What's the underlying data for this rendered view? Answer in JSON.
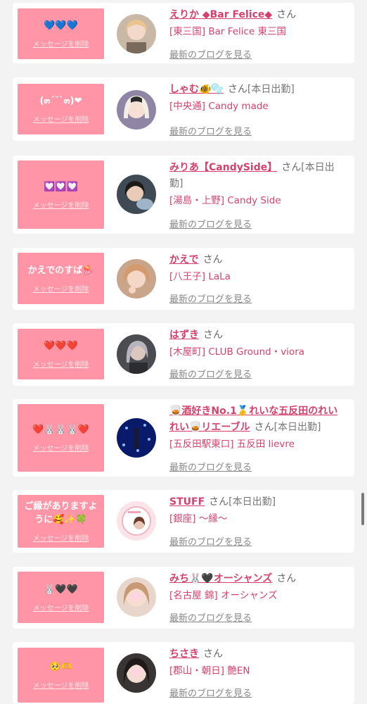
{
  "items": [
    {
      "message": "💙💙💙",
      "delete_label": "メッセージを削除",
      "name": "えりか ◆Bar Felice◆",
      "honorific": "さん",
      "tag": "",
      "shop": "[東三国] Bar Felice 東三国",
      "blog_label": "最新のブログを見る",
      "avatar_icon": "profile-photo-icon"
    },
    {
      "message": "(๓´˘`๓)❤",
      "delete_label": "メッセージを削除",
      "name": "しゃむ🐠🫧",
      "honorific": "さん",
      "tag": "[本日出勤]",
      "shop": "[中央通] Candy made",
      "blog_label": "最新のブログを見る",
      "avatar_icon": "profile-photo-icon"
    },
    {
      "message": "💟💟💟",
      "delete_label": "メッセージを削除",
      "name": "みりあ【CandySide】",
      "honorific": "さん",
      "tag": "[本日出勤]",
      "shop": "[湯島・上野] Candy Side",
      "blog_label": "最新のブログを見る",
      "avatar_icon": "profile-photo-icon"
    },
    {
      "message": "かえでのすば🪼",
      "delete_label": "メッセージを削除",
      "name": "かえで",
      "honorific": "さん",
      "tag": "",
      "shop": "[八王子] LaLa",
      "blog_label": "最新のブログを見る",
      "avatar_icon": "profile-photo-icon"
    },
    {
      "message": "❤️❤️❤️",
      "delete_label": "メッセージを削除",
      "name": "はずき",
      "honorific": "さん",
      "tag": "",
      "shop": "[木屋町] CLUB Ground・viora",
      "blog_label": "最新のブログを見る",
      "avatar_icon": "profile-photo-icon"
    },
    {
      "message": "❤️🐰🐰🐰❤️",
      "delete_label": "メッセージを削除",
      "name": "🥃酒好きNo.1🥇れいな五反田のれいれい🥃リエーブル",
      "honorific": "さん",
      "tag": "[本日出勤]",
      "shop": "[五反田駅東口] 五反田 lievre",
      "blog_label": "最新のブログを見る",
      "avatar_icon": "profile-photo-icon"
    },
    {
      "message": "ご縁がありますように🥰✨🍀",
      "delete_label": "メッセージを削除",
      "name": "STUFF",
      "honorific": "さん",
      "tag": "[本日出勤]",
      "shop": "[銀座] 〜縁〜",
      "blog_label": "最新のブログを見る",
      "avatar_icon": "profile-photo-icon"
    },
    {
      "message": "🐰🖤🖤",
      "delete_label": "メッセージを削除",
      "name": "みち🐰🖤オーシャンズ",
      "honorific": "さん",
      "tag": "",
      "shop": "[名古屋 錦] オーシャンズ",
      "blog_label": "最新のブログを見る",
      "avatar_icon": "profile-photo-icon"
    },
    {
      "message": "🥺🫶",
      "delete_label": "メッセージを削除",
      "name": "ちさき",
      "honorific": "さん",
      "tag": "",
      "shop": "[郡山・朝日] 艶EN",
      "blog_label": "最新のブログを見る",
      "avatar_icon": "profile-photo-icon"
    }
  ],
  "colors": {
    "accent": "#d4426c",
    "message_box": "#ff95a6",
    "background": "#f3f3f3"
  }
}
